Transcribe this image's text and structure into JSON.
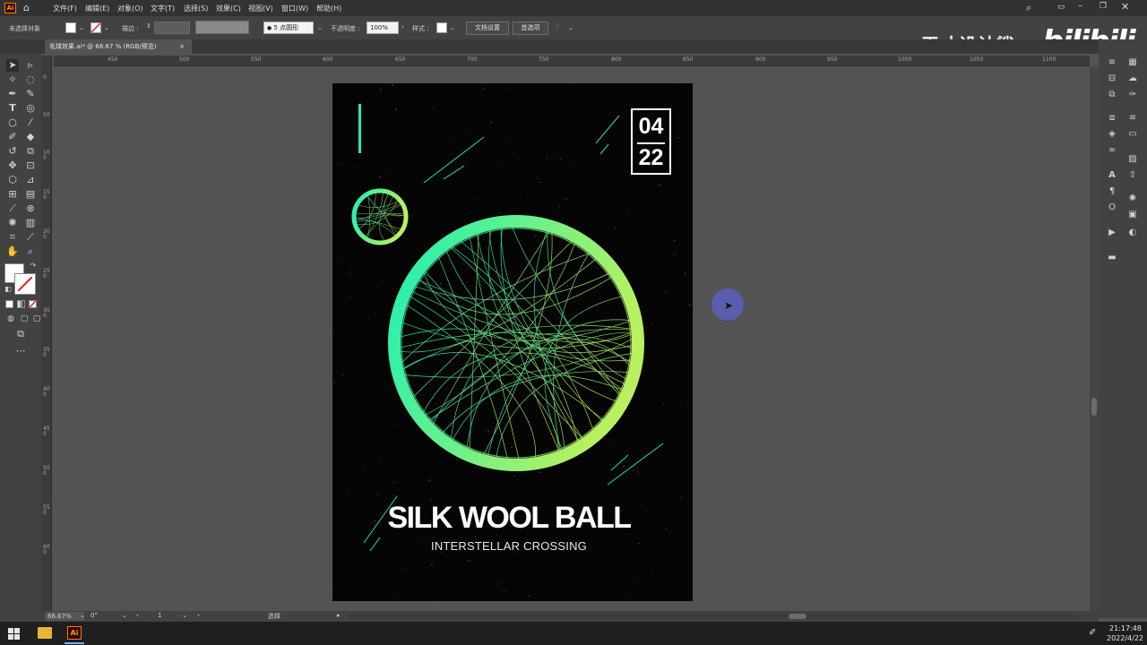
{
  "app": {
    "name": "Ai",
    "menu": [
      "文件(F)",
      "编辑(E)",
      "对象(O)",
      "文字(T)",
      "选择(S)",
      "效果(C)",
      "视图(V)",
      "窗口(W)",
      "帮助(H)"
    ]
  },
  "control_bar": {
    "selection_label": "未选择对象",
    "stroke_label": "描边 :",
    "brush_label": "5 点圆形",
    "opacity_label": "不透明度 :",
    "opacity_value": "100%",
    "style_label": "样式 :",
    "doc_setup_label": "文档设置",
    "preferences_label": "首选项"
  },
  "document_tab": {
    "title": "毛球效果.ai* @ 66.67 % (RGB/预览)",
    "close": "×"
  },
  "ruler_top": [
    "450",
    "500",
    "550",
    "600",
    "650",
    "700",
    "750",
    "800",
    "850",
    "900",
    "950",
    "1000",
    "1050",
    "1100"
  ],
  "ruler_left": [
    "0",
    "50",
    "100",
    "150",
    "200",
    "250",
    "300",
    "350",
    "400",
    "450",
    "500",
    "550",
    "600"
  ],
  "poster": {
    "date_top": "04",
    "date_bottom": "22",
    "title": "SILK WOOL BALL",
    "subtitle": "INTERSTELLAR CROSSING",
    "gradient_start": "#1ef0b4",
    "gradient_end": "#b8f060",
    "background": "#050505"
  },
  "status_bar": {
    "zoom": "66.67%",
    "rotation": "0°",
    "artboard": "1",
    "mode": "选择"
  },
  "watermark": {
    "text": "天才设计鲨",
    "logo": "bilibili"
  },
  "taskbar": {
    "time": "21:17:48",
    "date": "2022/4/22"
  }
}
